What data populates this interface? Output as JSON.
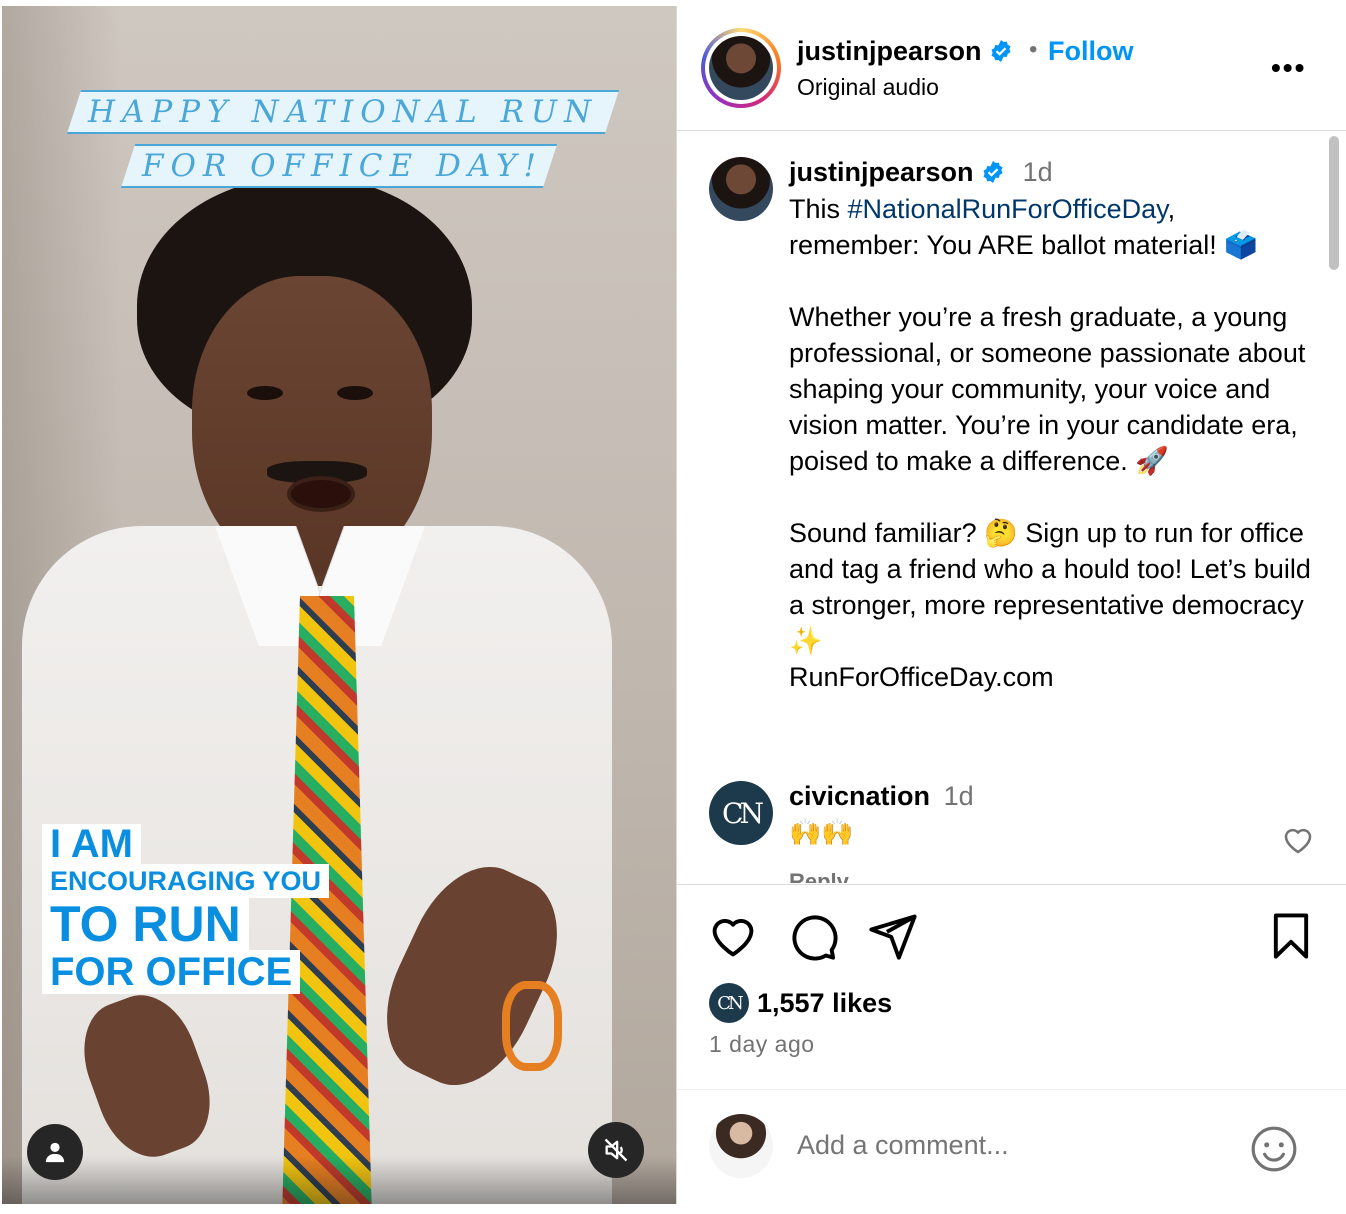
{
  "media": {
    "banner_line1": "HAPPY NATIONAL RUN",
    "banner_line2": "FOR OFFICE DAY!",
    "cta_line1": "I AM",
    "cta_line2": "ENCOURAGING YOU",
    "cta_line3": "TO RUN",
    "cta_line4": "FOR OFFICE",
    "user_icon": "user-icon",
    "mute_icon": "muted-speaker-icon"
  },
  "header": {
    "username": "justinjpearson",
    "separator": "•",
    "follow_label": "Follow",
    "audio": "Original audio",
    "more_label": "•••"
  },
  "caption": {
    "username": "justinjpearson",
    "time": "1d",
    "text_before": "This ",
    "hashtag": "#NationalRunForOfficeDay",
    "text_after": ",\nremember: You ARE ballot material! 🗳️\n\nWhether you’re a fresh graduate, a young professional, or someone passionate about shaping your community, your voice and vision matter. You’re in your candidate era, poised to make a difference. 🚀\n\nSound familiar? 🤔 Sign up to run for office and tag a friend who a hould too! Let’s build a stronger, more representative democracy ✨\nRunForOfficeDay.com"
  },
  "comment": {
    "avatar_text": "CN",
    "username": "civicnation",
    "time": "1d",
    "text": "🙌🙌",
    "reply_label": "Reply"
  },
  "actions": {
    "likes_avatar_text": "CN",
    "likes": "1,557 likes",
    "time_ago": "1 day ago"
  },
  "comment_bar": {
    "placeholder": "Add a comment..."
  },
  "colors": {
    "accent": "#0095f6",
    "hashtag": "#00376b",
    "muted": "#737373",
    "cta_blue": "#0a8fe0",
    "banner_text": "#4aa7d8",
    "cn_bg": "#1d3a4d"
  }
}
